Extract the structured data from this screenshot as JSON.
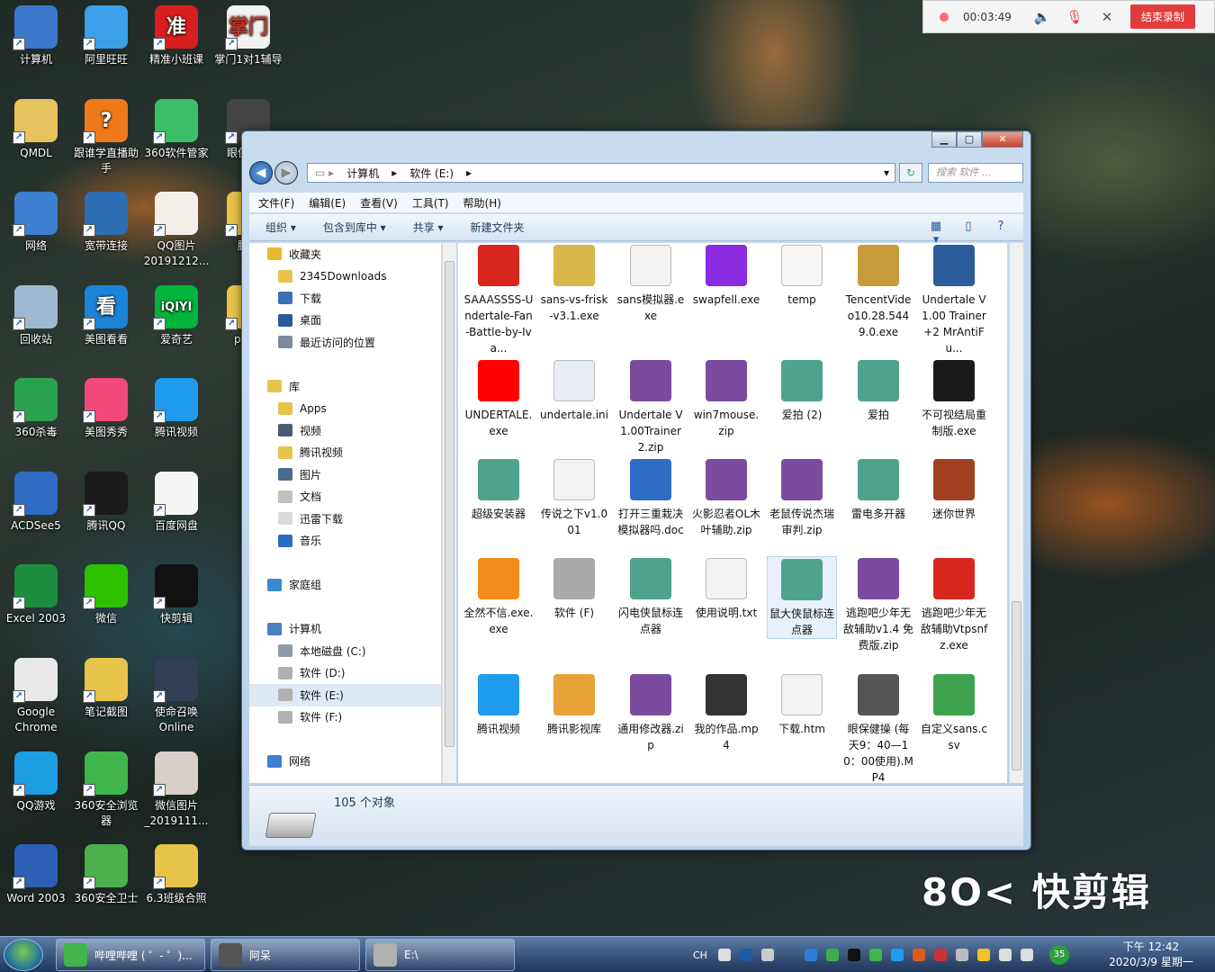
{
  "desktop_icons": [
    {
      "label": "计算机",
      "color": "#3a78c9"
    },
    {
      "label": "阿里旺旺",
      "color": "#3aa0e8"
    },
    {
      "label": "精准小班课",
      "color": "#d81e1e",
      "glyph": "准"
    },
    {
      "label": "掌门1对1辅导",
      "color": "#f2f2f2",
      "glyph": "掌门"
    },
    {
      "label": "QMDL",
      "color": "#e8c25c"
    },
    {
      "label": "跟谁学直播助手",
      "color": "#f07a1a",
      "glyph": "?"
    },
    {
      "label": "360软件管家",
      "color": "#3bbf6a"
    },
    {
      "label": "眼保每天",
      "color": "#444"
    },
    {
      "label": "网络",
      "color": "#3d7fd0"
    },
    {
      "label": "宽带连接",
      "color": "#2d6db3"
    },
    {
      "label": "QQ图片20191212...",
      "color": "#f4efe6"
    },
    {
      "label": "腾讯",
      "color": "#e7c34a"
    },
    {
      "label": "回收站",
      "color": "#9fb8d1"
    },
    {
      "label": "美图看看",
      "color": "#1a84d8",
      "glyph": "看"
    },
    {
      "label": "爱奇艺",
      "color": "#00b43c",
      "glyph": "iQIYI"
    },
    {
      "label": "ppt专",
      "color": "#e7c34a"
    },
    {
      "label": "360杀毒",
      "color": "#2aa14d"
    },
    {
      "label": "美图秀秀",
      "color": "#f0497a"
    },
    {
      "label": "腾讯视频",
      "color": "#1f9bef"
    },
    {
      "label": "ACDSee5",
      "color": "#2f6cc4"
    },
    {
      "label": "腾讯QQ",
      "color": "#1b1b1b"
    },
    {
      "label": "百度网盘",
      "color": "#f5f5f5"
    },
    {
      "label": "Excel 2003",
      "color": "#1e8e3e"
    },
    {
      "label": "微信",
      "color": "#2dc100"
    },
    {
      "label": "快剪辑",
      "color": "#111"
    },
    {
      "label": "Google Chrome",
      "color": "#e9e9e9"
    },
    {
      "label": "笔记截图",
      "color": "#e7c34a"
    },
    {
      "label": "使命召唤Online",
      "color": "#333f57"
    },
    {
      "label": "QQ游戏",
      "color": "#1d9de2"
    },
    {
      "label": "360安全浏览器",
      "color": "#3fb54b"
    },
    {
      "label": "微信图片_2019111...",
      "color": "#d7d0c8"
    },
    {
      "label": "Word 2003",
      "color": "#2d5fb4"
    },
    {
      "label": "360安全卫士",
      "color": "#4cb04c"
    },
    {
      "label": "6.3班级合照",
      "color": "#e7c34a"
    }
  ],
  "recorder": {
    "time": "00:03:49",
    "stop_label": "结束录制"
  },
  "window": {
    "breadcrumb": [
      "计算机",
      "软件 (E:)"
    ],
    "search_placeholder": "搜索 软件 ...",
    "menu": [
      "文件(F)",
      "编辑(E)",
      "查看(V)",
      "工具(T)",
      "帮助(H)"
    ],
    "toolbar": [
      "组织 ▾",
      "包含到库中 ▾",
      "共享 ▾",
      "新建文件夹"
    ],
    "nav": [
      {
        "label": "收藏夹",
        "level": 1,
        "color": "#e8b830"
      },
      {
        "label": "2345Downloads",
        "level": 2,
        "color": "#e7c34a"
      },
      {
        "label": "下载",
        "level": 2,
        "color": "#3b6fb6"
      },
      {
        "label": "桌面",
        "level": 2,
        "color": "#2a5a9e"
      },
      {
        "label": "最近访问的位置",
        "level": 2,
        "color": "#7a8a9a"
      },
      {
        "label": "",
        "level": 0
      },
      {
        "label": "库",
        "level": 1,
        "color": "#e7c34a"
      },
      {
        "label": "Apps",
        "level": 2,
        "color": "#e7c34a"
      },
      {
        "label": "视频",
        "level": 2,
        "color": "#4a5b73"
      },
      {
        "label": "腾讯视频",
        "level": 2,
        "color": "#e7c34a"
      },
      {
        "label": "图片",
        "level": 2,
        "color": "#4a6b8e"
      },
      {
        "label": "文档",
        "level": 2,
        "color": "#bfbfbf"
      },
      {
        "label": "迅雷下载",
        "level": 2,
        "color": "#dadada"
      },
      {
        "label": "音乐",
        "level": 2,
        "color": "#2a6ec4"
      },
      {
        "label": "",
        "level": 0
      },
      {
        "label": "家庭组",
        "level": 1,
        "color": "#3b8bd2"
      },
      {
        "label": "",
        "level": 0
      },
      {
        "label": "计算机",
        "level": 1,
        "color": "#4a7fc0"
      },
      {
        "label": "本地磁盘 (C:)",
        "level": 2,
        "color": "#8e9aa8"
      },
      {
        "label": "软件 (D:)",
        "level": 2,
        "color": "#b0b0b0"
      },
      {
        "label": "软件 (E:)",
        "level": 2,
        "color": "#b0b0b0",
        "selected": true
      },
      {
        "label": "软件 (F:)",
        "level": 2,
        "color": "#b0b0b0"
      },
      {
        "label": "",
        "level": 0
      },
      {
        "label": "网络",
        "level": 1,
        "color": "#3d7fd0"
      }
    ],
    "files": [
      [
        "SAAASSSS-Undertale-Fan-Battle-by-Iva...",
        "#d8261e"
      ],
      [
        "sans-vs-frisk-v3.1.exe",
        "#d9b64a"
      ],
      [
        "sans模拟器.exe",
        "#f2f2f2"
      ],
      [
        "swapfell.exe",
        "#8a2be2"
      ],
      [
        "temp",
        "#f7f7f7"
      ],
      [
        "TencentVideo10.28.5449.0.exe",
        "#c79b3a"
      ],
      [
        "Undertale V1.00 Trainer +2 MrAntiFu...",
        "#2b5d9a"
      ],
      [
        "UNDERTALE.exe",
        "#ff0000"
      ],
      [
        "undertale.ini",
        "#e8edf3"
      ],
      [
        "Undertale V1.00Trainer2.zip",
        "#7a4b9e"
      ],
      [
        "win7mouse.zip",
        "#7a4b9e"
      ],
      [
        "爱拍 (2)",
        "#4fa38c"
      ],
      [
        "爱拍",
        "#4fa38c"
      ],
      [
        "不可视结局重制版.exe",
        "#1a1a1a"
      ],
      [
        "超级安装器",
        "#4fa38c"
      ],
      [
        "传说之下v1.001",
        "#f2f2f2"
      ],
      [
        "打开三重栽决模拟器吗.doc",
        "#2f6cc4"
      ],
      [
        "火影忍者OL木叶辅助.zip",
        "#7a4b9e"
      ],
      [
        "老鼠传说杰瑞审判.zip",
        "#7a4b9e"
      ],
      [
        "雷电多开器",
        "#4fa38c"
      ],
      [
        "迷你世界",
        "#a04020"
      ],
      [
        "全然不信.exe.exe",
        "#f28c18"
      ],
      [
        "软件 (F)",
        "#a9a9a9"
      ],
      [
        "闪电侠鼠标连点器",
        "#4fa38c"
      ],
      [
        "使用说明.txt",
        "#f2f2f2"
      ],
      [
        "鼠大侠鼠标连点器",
        "#4fa38c"
      ],
      [
        "逃跑吧少年无敌辅助v1.4 免费版.zip",
        "#7a4b9e"
      ],
      [
        "逃跑吧少年无敌辅助Vtpsnfz.exe",
        "#d8261e"
      ],
      [
        "腾讯视频",
        "#1f9bef"
      ],
      [
        "腾讯影视库",
        "#e7a23a"
      ],
      [
        "通用修改器.zip",
        "#7a4b9e"
      ],
      [
        "我的作品.mp4",
        "#333"
      ],
      [
        "下载.htm",
        "#f2f2f2"
      ],
      [
        "眼保健操 (每天9：40—10：00使用).MP4",
        "#555"
      ],
      [
        "自定义sans.csv",
        "#3fa34d"
      ]
    ],
    "status_count": "105 个对象"
  },
  "watermark": "8O< 快剪辑",
  "taskbar": {
    "buttons": [
      {
        "label": "哔哩哔哩 ( ゜- ゜)...",
        "color": "#3fb54b"
      },
      {
        "label": "阿呆",
        "color": "#555"
      },
      {
        "label": "E:\\",
        "color": "#b0b0b0"
      }
    ],
    "tray_lang": "CH",
    "tray_badge": "35",
    "clock_time": "下午 12:42",
    "clock_date": "2020/3/9 星期一"
  }
}
